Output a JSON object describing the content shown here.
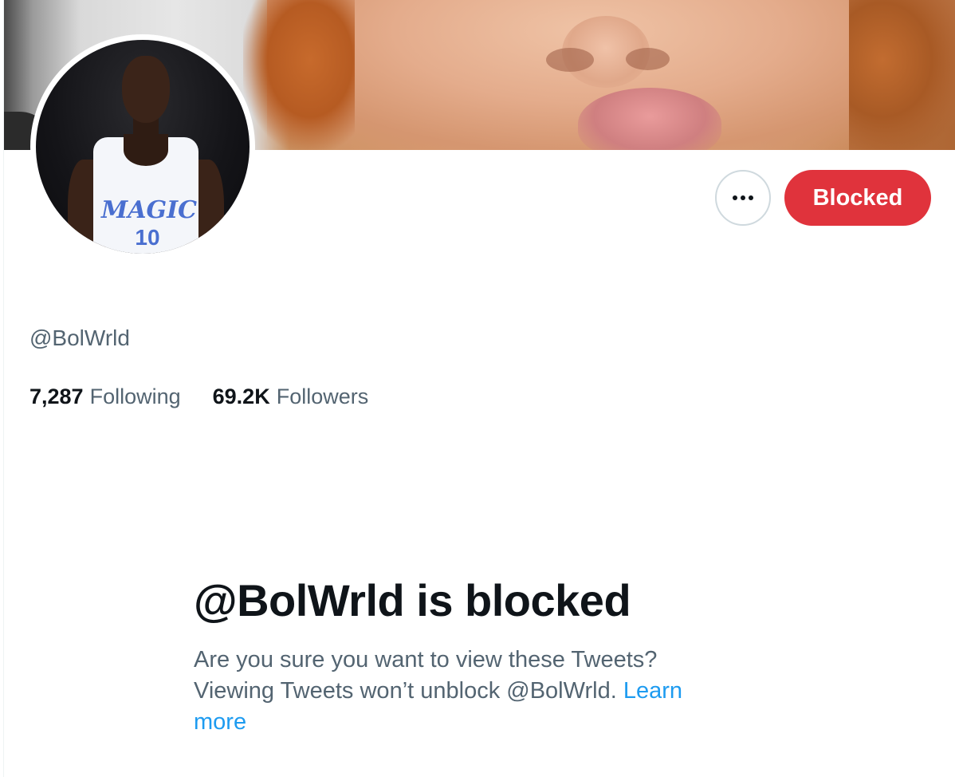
{
  "profile": {
    "handle": "@BolWrld",
    "avatar_jersey_text": "MAGIC",
    "avatar_jersey_number": "10"
  },
  "actions": {
    "more_icon": "ellipsis-icon",
    "blocked_label": "Blocked",
    "accent_color": "#e0333c"
  },
  "stats": {
    "following_count": "7,287",
    "following_label": "Following",
    "followers_count": "69.2K",
    "followers_label": "Followers"
  },
  "notice": {
    "title": "@BolWrld is blocked",
    "description": "Are you sure you want to view these Tweets? Viewing Tweets won’t unblock @BolWrld.",
    "link_label": "Learn more",
    "link_color": "#1d9bf0"
  }
}
